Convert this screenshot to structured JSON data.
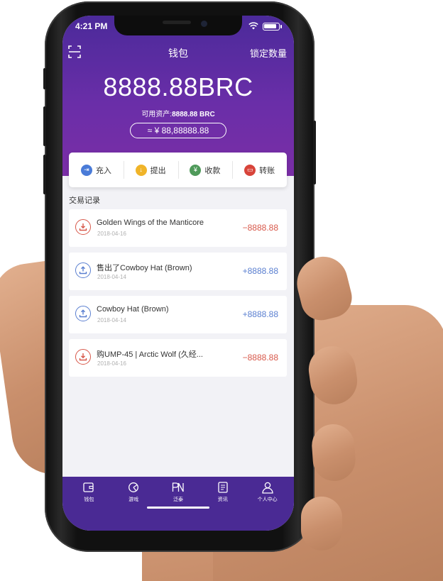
{
  "status_bar": {
    "time": "4:21 PM"
  },
  "navbar": {
    "title": "钱包",
    "right_label": "锁定数量"
  },
  "wallet": {
    "balance": "8888.88BRC",
    "available_label": "可用资产:",
    "available_value": "8888.88 BRC",
    "cny_value": "≈ ¥ 88,88888.88"
  },
  "actions": [
    {
      "label": "充入",
      "icon": "deposit-icon",
      "color": "#4a7bd8"
    },
    {
      "label": "提出",
      "icon": "withdraw-icon",
      "color": "#f0b429"
    },
    {
      "label": "收款",
      "icon": "receive-icon",
      "color": "#4f9a5a"
    },
    {
      "label": "转账",
      "icon": "transfer-icon",
      "color": "#d8443a"
    }
  ],
  "section_title": "交易记录",
  "transactions": [
    {
      "title": "Golden Wings of the Manticore",
      "date": "2018-04-16",
      "amount": "−8888.88",
      "direction": "out",
      "icon": "download-icon"
    },
    {
      "title": "售出了Cowboy Hat (Brown)",
      "date": "2018-04-14",
      "amount": "+8888.88",
      "direction": "in",
      "icon": "upload-icon"
    },
    {
      "title": "Cowboy Hat (Brown)",
      "date": "2018-04-14",
      "amount": "+8888.88",
      "direction": "in",
      "icon": "upload-icon"
    },
    {
      "title": "购UMP-45 | Arctic Wolf (久经...",
      "date": "2018-04-16",
      "amount": "−8888.88",
      "direction": "out",
      "icon": "download-icon"
    }
  ],
  "colors": {
    "out": "#d8584a",
    "in": "#5a7fd0",
    "brand": "#5a2ea6"
  },
  "tabs": [
    {
      "label": "钱包",
      "icon": "wallet-icon"
    },
    {
      "label": "游戏",
      "icon": "game-icon"
    },
    {
      "label": "泛泰",
      "icon": "pn-icon"
    },
    {
      "label": "资讯",
      "icon": "news-icon"
    },
    {
      "label": "个人中心",
      "icon": "profile-icon"
    }
  ]
}
